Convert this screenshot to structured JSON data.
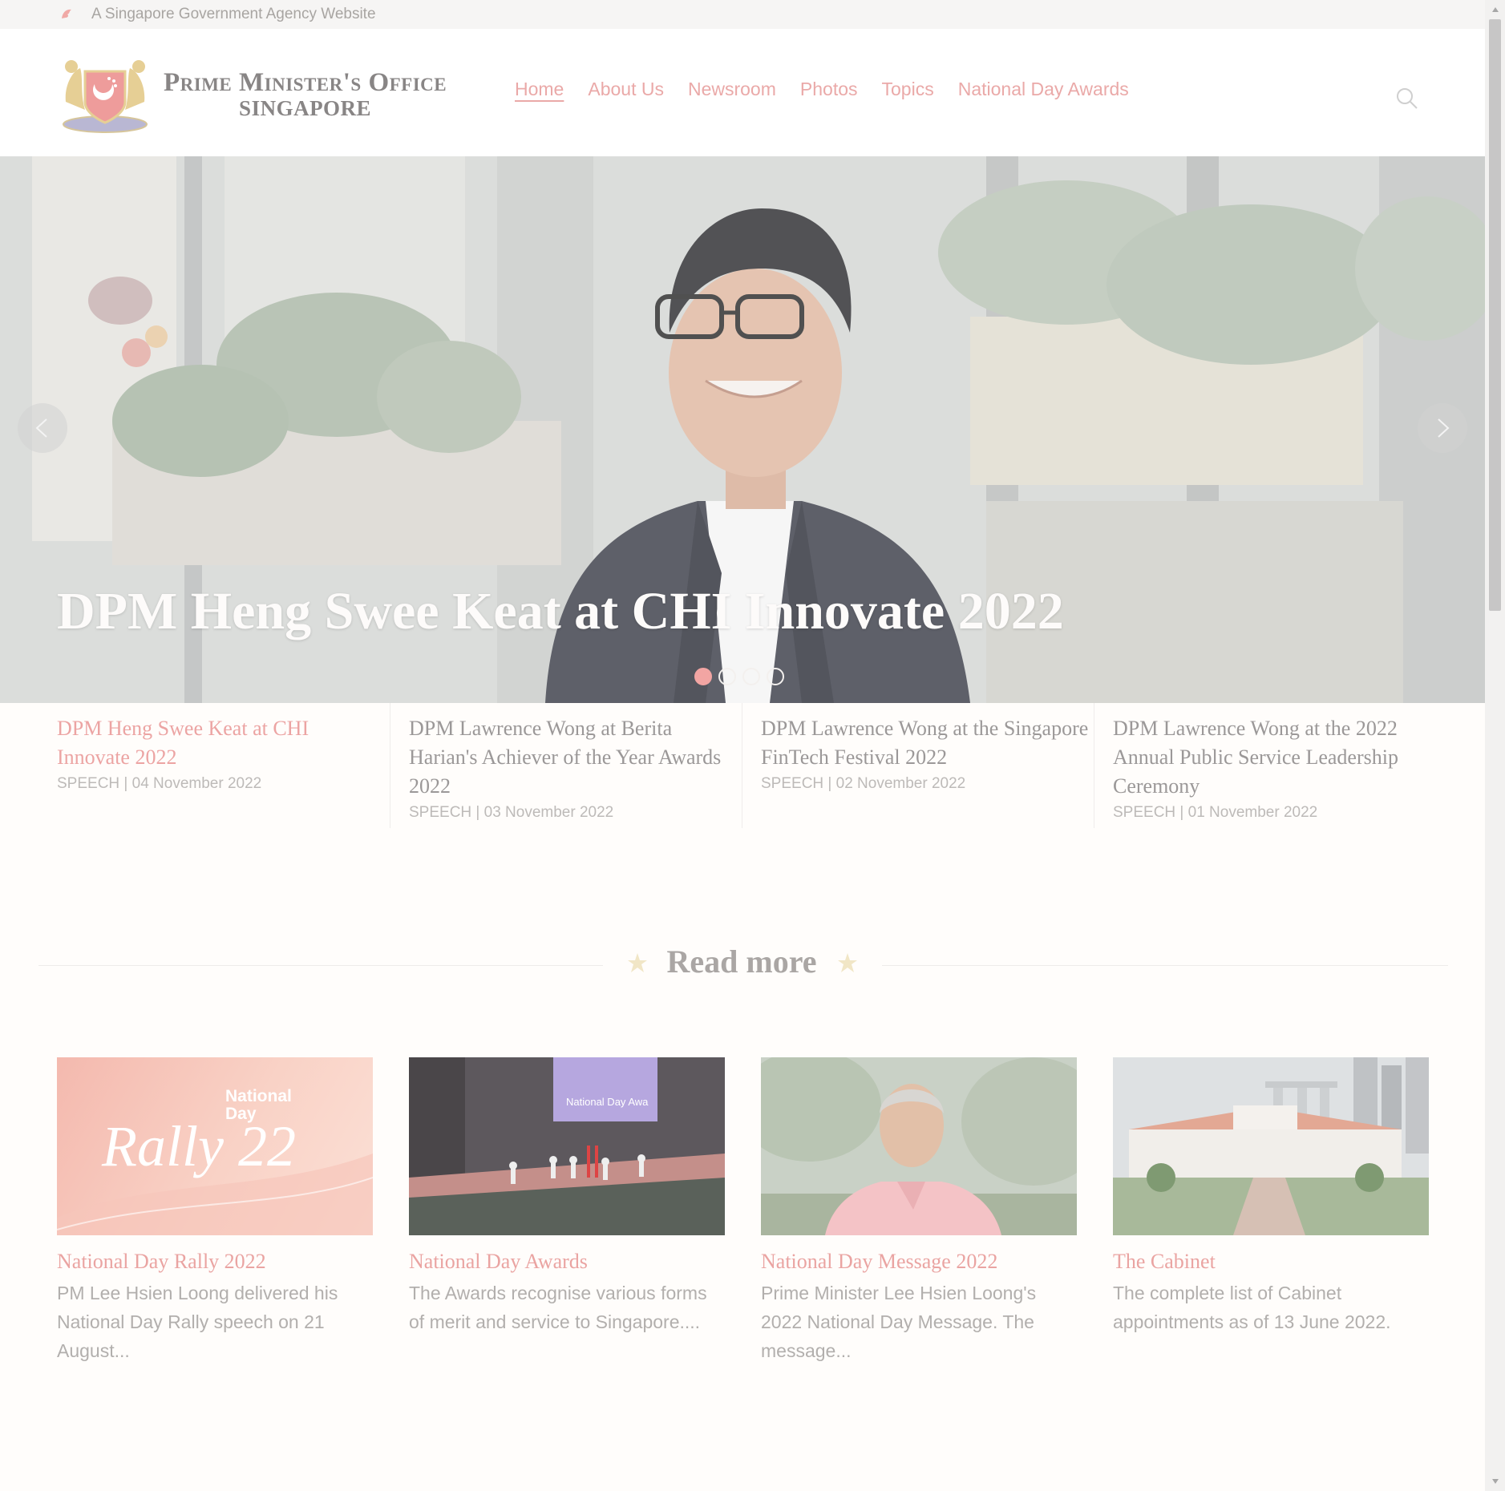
{
  "masthead": {
    "text": "A Singapore Government Agency Website"
  },
  "logo": {
    "line1": "Prime Minister's Office",
    "line2": "SINGAPORE"
  },
  "nav": [
    {
      "label": "Home",
      "active": true
    },
    {
      "label": "About Us"
    },
    {
      "label": "Newsroom"
    },
    {
      "label": "Photos"
    },
    {
      "label": "Topics"
    },
    {
      "label": "National Day Awards"
    }
  ],
  "hero": {
    "title": "DPM Heng Swee Keat at CHI Innovate 2022",
    "slide_count": 4,
    "active_slide": 1
  },
  "headlines": [
    {
      "title": "DPM Heng Swee Keat at CHI Innovate 2022",
      "meta": "SPEECH | 04 November 2022"
    },
    {
      "title": "DPM Lawrence Wong at Berita Harian's Achiever of the Year Awards 2022",
      "meta": "SPEECH | 03 November 2022"
    },
    {
      "title": "DPM Lawrence Wong at the Singapore FinTech Festival 2022",
      "meta": "SPEECH | 02 November 2022"
    },
    {
      "title": "DPM Lawrence Wong at the 2022 Annual Public Service Leadership Ceremony",
      "meta": "SPEECH | 01 November 2022"
    }
  ],
  "read_more": {
    "title": "Read more"
  },
  "cards": [
    {
      "title": "National Day Rally 2022",
      "desc": "PM Lee Hsien Loong delivered his National Day Rally speech on 21 August...",
      "image_text": {
        "top1": "National",
        "top2": "Day",
        "script": "Rally 22"
      }
    },
    {
      "title": "National Day Awards",
      "desc": "The Awards recognise various forms of merit and service to Singapore....",
      "image_text": {
        "screen": "National Day Awa"
      }
    },
    {
      "title": "National Day Message 2022",
      "desc": "Prime Minister Lee Hsien Loong's 2022 National Day Message. The message..."
    },
    {
      "title": "The Cabinet",
      "desc": "The complete list of Cabinet appointments as of 13 June 2022."
    }
  ],
  "colors": {
    "accent": "#eaa4a2",
    "masthead_bg": "#f6f5f4",
    "page_bg": "#fffdfb"
  },
  "icons": {
    "search": "search-icon",
    "prev": "chevron-left-icon",
    "next": "chevron-right-icon",
    "star": "star-icon"
  }
}
